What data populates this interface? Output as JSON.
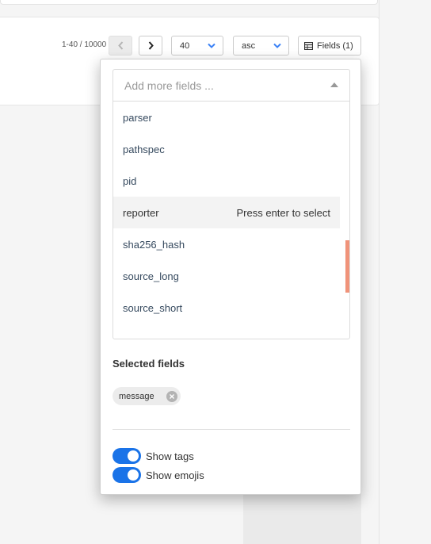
{
  "pagination": {
    "range": "1-40 / 10000",
    "page_size": "40",
    "order": "asc"
  },
  "fields_button": {
    "label": "Fields (1)"
  },
  "field_picker": {
    "placeholder": "Add more fields ...",
    "options": [
      {
        "label": "parser"
      },
      {
        "label": "pathspec"
      },
      {
        "label": "pid"
      },
      {
        "label": "reporter",
        "hint": "Press enter to select"
      },
      {
        "label": "sha256_hash"
      },
      {
        "label": "source_long"
      },
      {
        "label": "source_short"
      }
    ]
  },
  "selected": {
    "title": "Selected fields",
    "chips": [
      "message"
    ]
  },
  "toggles": {
    "show_tags": "Show tags",
    "show_emojis": "Show emojis"
  },
  "colors": {
    "accent": "#1a73e8",
    "scroll_thumb": "#f0937a",
    "option_text": "#35495e"
  }
}
